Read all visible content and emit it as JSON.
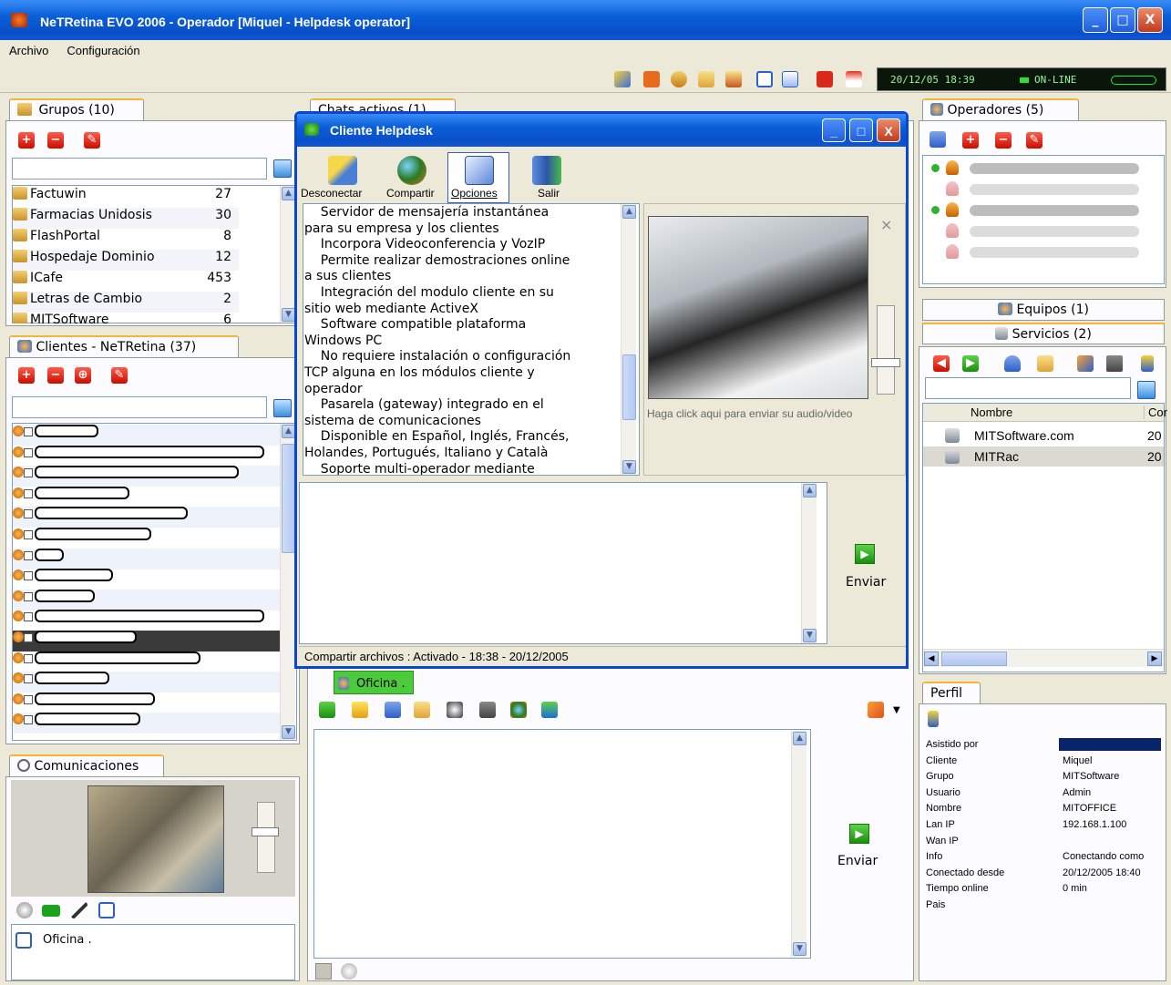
{
  "window": {
    "title": "NeTRetina EVO 2006 - Operador  [Miquel - Helpdesk operator]",
    "min": "_",
    "max": "□",
    "close": "X"
  },
  "menu": [
    "Archivo",
    "Configuración"
  ],
  "status": {
    "datetime": "20/12/05 18:39",
    "online": "ON-LINE"
  },
  "groups": {
    "tab": "Grupos (10)",
    "items": [
      {
        "name": "Factuwin",
        "count": "27"
      },
      {
        "name": "Farmacias Unidosis",
        "count": "30"
      },
      {
        "name": "FlashPortal",
        "count": "8"
      },
      {
        "name": "Hospedaje Dominio",
        "count": "12"
      },
      {
        "name": "ICafe",
        "count": "453"
      },
      {
        "name": "Letras de Cambio",
        "count": "2"
      },
      {
        "name": "MITSoftware",
        "count": "6"
      }
    ]
  },
  "clients": {
    "tab": "Clientes - NeTRetina (37)",
    "row_count": 15
  },
  "comms": {
    "tab": "Comunicaciones",
    "status": "Oficina ."
  },
  "chats_tab": "Chats activos (1)",
  "dialog": {
    "title": "Cliente Helpdesk",
    "buttons": [
      "Desconectar",
      "Compartir",
      "Opciones",
      "Salir"
    ],
    "info_lines": [
      "    Servidor de mensajería instantánea",
      "para su empresa y los clientes",
      "    Incorpora Videoconferencia y VozIP",
      "    Permite realizar demostraciones online",
      "a sus clientes",
      "    Integración del modulo cliente en su",
      "sitio web mediante ActiveX",
      "    Software compatible plataforma",
      "Windows PC",
      "    No requiere instalación o configuración",
      "TCP alguna en los módulos cliente y",
      "operador",
      "    Pasarela (gateway) integrado en el",
      "sistema de comunicaciones",
      "    Disponible en Español, Inglés, Francés,",
      "Holandes, Portugués, Italiano y Català",
      "    Soporte multi-operador mediante"
    ],
    "video_hint": "Haga click aqui para enviar su audio/video",
    "send": "Enviar",
    "status": "Compartir archivos : Activado - 18:38 - 20/12/2005"
  },
  "chat": {
    "tab": "Oficina .",
    "send": "Enviar"
  },
  "operators": {
    "tab": "Operadores (5)"
  },
  "teams": {
    "label": "Equipos (1)"
  },
  "services": {
    "label": "Servicios (2)",
    "col_name": "Nombre",
    "col_count": "Cor",
    "items": [
      {
        "name": "MITSoftware.com",
        "count": "20"
      },
      {
        "name": "MITRac",
        "count": "20"
      }
    ]
  },
  "profile": {
    "tab": "Perfil",
    "rows": [
      {
        "k": "Asistido por",
        "v": ""
      },
      {
        "k": "Cliente",
        "v": "Miquel"
      },
      {
        "k": "Grupo",
        "v": "MITSoftware"
      },
      {
        "k": "Usuario",
        "v": "Admin"
      },
      {
        "k": "Nombre",
        "v": "MITOFFICE"
      },
      {
        "k": "Lan IP",
        "v": "192.168.1.100"
      },
      {
        "k": "Wan IP",
        "v": ""
      },
      {
        "k": "Info",
        "v": "Conectando como"
      },
      {
        "k": "Conectado desde",
        "v": "20/12/2005 18:40"
      },
      {
        "k": "Tiempo online",
        "v": "0 min"
      },
      {
        "k": "Pais",
        "v": ""
      }
    ]
  }
}
